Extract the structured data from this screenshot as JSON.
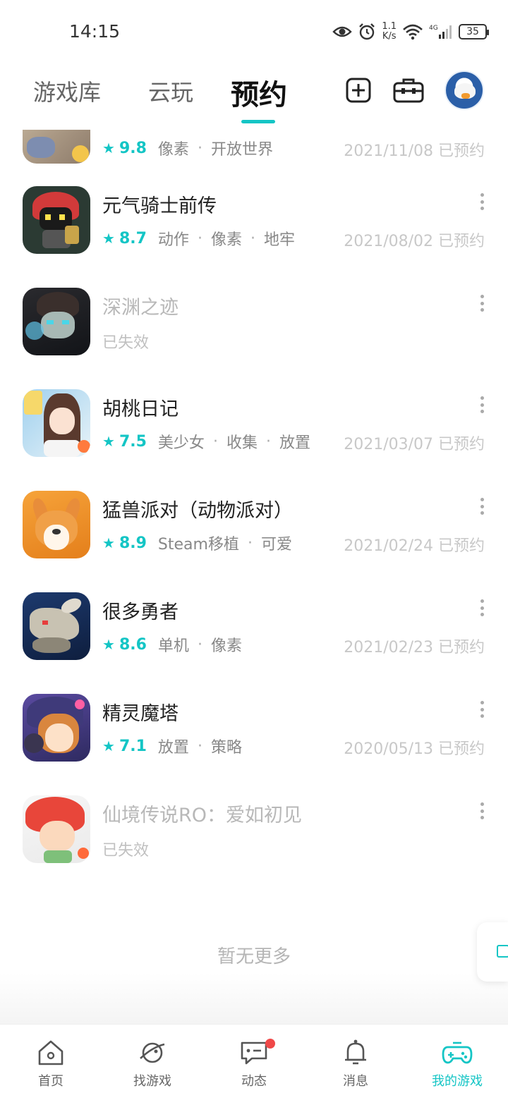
{
  "status_bar": {
    "time": "14:15",
    "net_speed_value": "1.1",
    "net_speed_unit": "K/s",
    "signal_type": "4G",
    "battery": "35"
  },
  "header": {
    "tabs": [
      {
        "label": "游戏库"
      },
      {
        "label": "云玩"
      },
      {
        "label": "预约"
      }
    ],
    "active_tab": "预约",
    "accent_color": "#14c5c5"
  },
  "games": [
    {
      "title": "",
      "score": "9.8",
      "tags": [
        "像素",
        "开放世界"
      ],
      "date": "2021/11/08 已预约",
      "partial": true
    },
    {
      "title": "元气骑士前传",
      "score": "8.7",
      "tags": [
        "动作",
        "像素",
        "地牢"
      ],
      "date": "2021/08/02 已预约"
    },
    {
      "title": "深渊之迹",
      "status": "已失效",
      "invalid": true
    },
    {
      "title": "胡桃日记",
      "score": "7.5",
      "tags": [
        "美少女",
        "收集",
        "放置"
      ],
      "date": "2021/03/07 已预约"
    },
    {
      "title": "猛兽派对（动物派对）",
      "score": "8.9",
      "tags": [
        "Steam移植",
        "可爱"
      ],
      "date": "2021/02/24 已预约"
    },
    {
      "title": "很多勇者",
      "score": "8.6",
      "tags": [
        "单机",
        "像素"
      ],
      "date": "2021/02/23 已预约"
    },
    {
      "title": "精灵魔塔",
      "score": "7.1",
      "tags": [
        "放置",
        "策略"
      ],
      "date": "2020/05/13 已预约"
    },
    {
      "title": "仙境传说RO：爱如初见",
      "status": "已失效",
      "invalid": true
    }
  ],
  "footer_text": "暂无更多",
  "bottom_nav": [
    {
      "label": "首页",
      "icon": "home-icon"
    },
    {
      "label": "找游戏",
      "icon": "planet-icon"
    },
    {
      "label": "动态",
      "icon": "chat-icon",
      "badge": true
    },
    {
      "label": "消息",
      "icon": "bell-icon"
    },
    {
      "label": "我的游戏",
      "icon": "gamepad-icon",
      "active": true
    }
  ]
}
